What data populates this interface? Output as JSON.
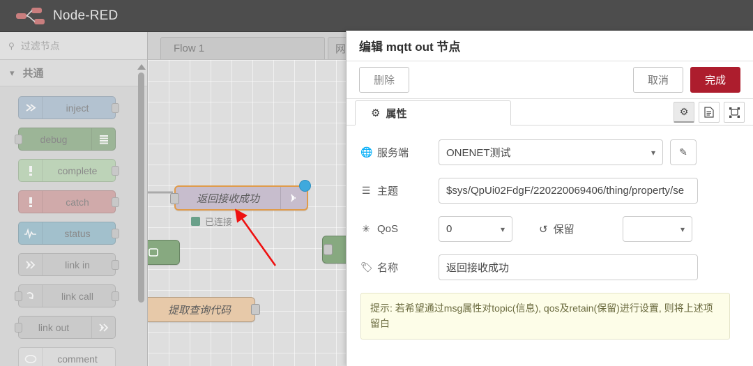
{
  "header": {
    "brand": "Node-RED",
    "logo_icon": "node-red-logo-icon"
  },
  "palette": {
    "search_placeholder": "过滤节点",
    "search_value": "",
    "search_icon": "search-icon",
    "chevron_icon": "chevron-down-icon",
    "category": "共通",
    "nodes": [
      {
        "label": "inject",
        "color": "#a6bbcf",
        "icon": "inject-arrow-icon",
        "icon_side": "left",
        "port_out": true,
        "port_in": false
      },
      {
        "label": "debug",
        "color": "#87a980",
        "icon": "debug-list-icon",
        "icon_side": "right",
        "port_out": false,
        "port_in": true
      },
      {
        "label": "complete",
        "color": "#b5d3ad",
        "icon": "exclamation-icon",
        "icon_side": "left",
        "port_out": true,
        "port_in": false
      },
      {
        "label": "catch",
        "color": "#cf9a9a",
        "icon": "exclamation-icon",
        "icon_side": "left",
        "port_out": true,
        "port_in": false
      },
      {
        "label": "status",
        "color": "#8fb8c9",
        "icon": "pulse-wave-icon",
        "icon_side": "left",
        "port_out": true,
        "port_in": false
      },
      {
        "label": "link in",
        "color": "#c7c7c7",
        "icon": "link-in-icon",
        "icon_side": "left",
        "port_out": true,
        "port_in": false
      },
      {
        "label": "link call",
        "color": "#c7c7c7",
        "icon": "link-call-icon",
        "icon_side": "left",
        "port_out": true,
        "port_in": true
      },
      {
        "label": "link out",
        "color": "#c7c7c7",
        "icon": "link-out-icon",
        "icon_side": "right",
        "port_out": false,
        "port_in": true
      },
      {
        "label": "comment",
        "color": "#dedede",
        "icon": "comment-icon",
        "icon_side": "left",
        "port_out": false,
        "port_in": false
      }
    ],
    "scroll_up_icon": "scroll-up-arrow-icon"
  },
  "workspace": {
    "tabs": [
      {
        "label": "Flow 1",
        "active": true
      },
      {
        "label": "网",
        "active": false
      }
    ],
    "canvas_nodes": [
      {
        "label": "返回接收成功",
        "color": "#c7bdcd",
        "selected": true,
        "icon": "mqtt-signal-icon",
        "status_text": "已连接",
        "status_color": "#6aa08a",
        "badge_icon": "blue-dot-badge"
      },
      {
        "label": "提取查询代码",
        "color": "#e7c9a9",
        "selected": false
      }
    ],
    "annotation_icon": "red-arrow-annotation"
  },
  "dialog": {
    "title": "编辑 mqtt out 节点",
    "buttons": {
      "delete": "删除",
      "cancel": "取消",
      "done": "完成"
    },
    "tab": {
      "label": "属性",
      "icon": "gear-icon"
    },
    "header_icons": [
      {
        "name": "gear-icon",
        "glyph": "⚙",
        "active": true
      },
      {
        "name": "document-icon",
        "glyph": "☰",
        "active": false
      },
      {
        "name": "resize-layout-icon",
        "glyph": "⧉",
        "active": false
      }
    ],
    "fields": {
      "server": {
        "label": "服务端",
        "icon": "globe-icon",
        "value": "ONENET测试",
        "edit_icon": "pencil-icon"
      },
      "topic": {
        "label": "主题",
        "icon": "list-icon",
        "value": "$sys/QpUi02FdgF/220220069406/thing/property/se"
      },
      "qos": {
        "label": "QoS",
        "icon": "asterisk-circle-icon",
        "value": "0"
      },
      "retain": {
        "label": "保留",
        "icon": "undo-icon",
        "value": ""
      },
      "name": {
        "label": "名称",
        "icon": "tag-icon",
        "value": "返回接收成功"
      }
    },
    "tip": "提示: 若希望通过msg属性对topic(信息), qos及retain(保留)进行设置, 则将上述项留白"
  },
  "colors": {
    "header_bg": "#4d4d4d",
    "primary_button": "#ad1d2d",
    "selection_border": "#e09b4a",
    "status_connected": "#6aa08a",
    "annotation": "#ee1111"
  }
}
